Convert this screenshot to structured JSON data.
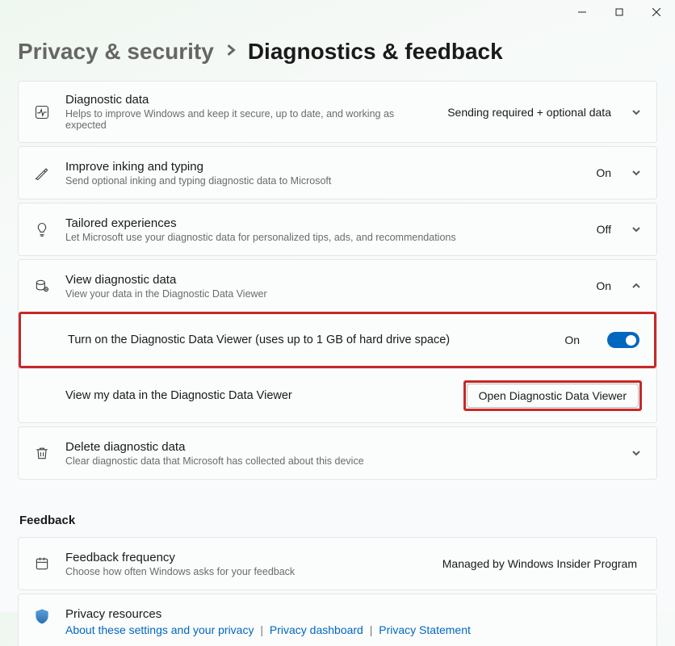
{
  "breadcrumb": {
    "parent": "Privacy & security",
    "current": "Diagnostics & feedback"
  },
  "cards": {
    "diagnostic_data": {
      "title": "Diagnostic data",
      "sub": "Helps to improve Windows and keep it secure, up to date, and working as expected",
      "status": "Sending required + optional data"
    },
    "inking": {
      "title": "Improve inking and typing",
      "sub": "Send optional inking and typing diagnostic data to Microsoft",
      "status": "On"
    },
    "tailored": {
      "title": "Tailored experiences",
      "sub": "Let Microsoft use your diagnostic data for personalized tips, ads, and recommendations",
      "status": "Off"
    },
    "view_diag": {
      "title": "View diagnostic data",
      "sub": "View your data in the Diagnostic Data Viewer",
      "status": "On",
      "toggle_row": {
        "label": "Turn on the Diagnostic Data Viewer (uses up to 1 GB of hard drive space)",
        "status": "On"
      },
      "viewer_row": {
        "label": "View my data in the Diagnostic Data Viewer",
        "button": "Open Diagnostic Data Viewer"
      }
    },
    "delete_diag": {
      "title": "Delete diagnostic data",
      "sub": "Clear diagnostic data that Microsoft has collected about this device"
    },
    "feedback_freq": {
      "title": "Feedback frequency",
      "sub": "Choose how often Windows asks for your feedback",
      "status": "Managed by Windows Insider Program"
    },
    "privacy_res": {
      "title": "Privacy resources",
      "link1": "About these settings and your privacy",
      "link2": "Privacy dashboard",
      "link3": "Privacy Statement"
    }
  },
  "section": {
    "feedback": "Feedback"
  }
}
